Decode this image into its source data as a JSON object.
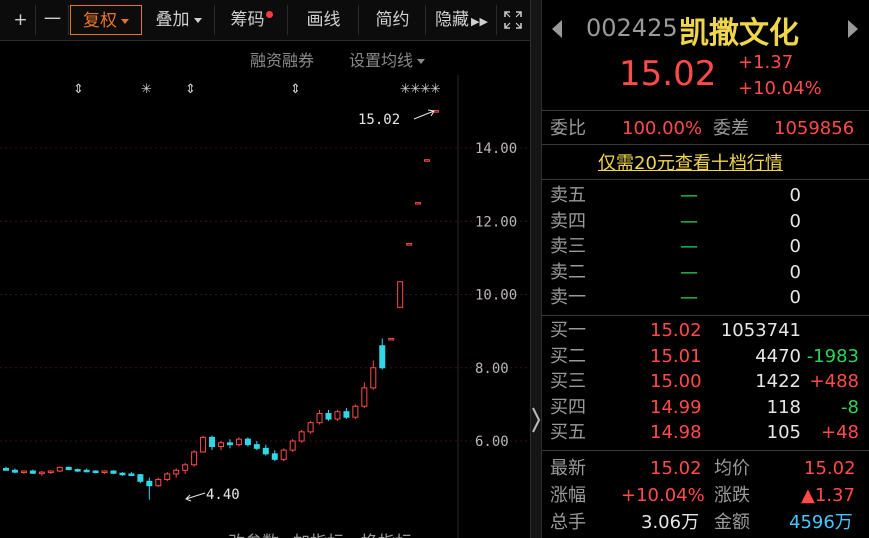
{
  "toolbar": {
    "plus": "+",
    "minus": "一",
    "fuquan": "复权",
    "diejia": "叠加",
    "chouma": "筹码",
    "huaxian": "画线",
    "jianyue": "简约",
    "yincang": "隐藏"
  },
  "chart_sub": {
    "rongzi": "融资融券",
    "junxian": "设置均线"
  },
  "chart_data": {
    "type": "candlestick",
    "yticks": [
      "14.00",
      "12.00",
      "10.00",
      "8.00",
      "6.00"
    ],
    "ylim": [
      4.0,
      15.6
    ],
    "annotation_high": "15.02",
    "annotation_low": "4.40",
    "candles": [
      [
        5.25,
        5.3,
        5.2,
        5.2
      ],
      [
        5.2,
        5.25,
        5.12,
        5.15
      ],
      [
        5.15,
        5.2,
        5.1,
        5.18
      ],
      [
        5.18,
        5.22,
        5.1,
        5.12
      ],
      [
        5.12,
        5.18,
        5.05,
        5.15
      ],
      [
        5.15,
        5.2,
        5.1,
        5.18
      ],
      [
        5.18,
        5.3,
        5.15,
        5.28
      ],
      [
        5.28,
        5.3,
        5.2,
        5.22
      ],
      [
        5.22,
        5.25,
        5.15,
        5.2
      ],
      [
        5.2,
        5.25,
        5.15,
        5.18
      ],
      [
        5.18,
        5.2,
        5.12,
        5.15
      ],
      [
        5.15,
        5.2,
        5.1,
        5.18
      ],
      [
        5.18,
        5.2,
        5.1,
        5.12
      ],
      [
        5.12,
        5.15,
        5.05,
        5.1
      ],
      [
        5.1,
        5.15,
        5.05,
        5.08
      ],
      [
        5.08,
        5.1,
        4.85,
        4.9
      ],
      [
        4.9,
        5.0,
        4.4,
        4.78
      ],
      [
        4.78,
        5.0,
        4.75,
        4.95
      ],
      [
        4.95,
        5.15,
        4.9,
        5.1
      ],
      [
        5.1,
        5.25,
        5.0,
        5.2
      ],
      [
        5.2,
        5.4,
        5.1,
        5.35
      ],
      [
        5.35,
        5.75,
        5.3,
        5.7
      ],
      [
        5.7,
        6.15,
        5.7,
        6.1
      ],
      [
        6.1,
        6.15,
        5.75,
        5.85
      ],
      [
        5.85,
        6.0,
        5.75,
        5.95
      ],
      [
        5.95,
        6.05,
        5.8,
        5.9
      ],
      [
        5.9,
        6.1,
        5.85,
        6.05
      ],
      [
        6.05,
        6.1,
        5.85,
        5.9
      ],
      [
        5.9,
        6.0,
        5.75,
        5.8
      ],
      [
        5.8,
        5.9,
        5.6,
        5.65
      ],
      [
        5.65,
        5.75,
        5.45,
        5.5
      ],
      [
        5.5,
        5.8,
        5.45,
        5.75
      ],
      [
        5.75,
        6.05,
        5.7,
        6.0
      ],
      [
        6.0,
        6.3,
        5.95,
        6.25
      ],
      [
        6.25,
        6.55,
        6.2,
        6.5
      ],
      [
        6.5,
        6.85,
        6.45,
        6.75
      ],
      [
        6.75,
        6.85,
        6.55,
        6.6
      ],
      [
        6.6,
        6.85,
        6.55,
        6.8
      ],
      [
        6.8,
        6.9,
        6.6,
        6.65
      ],
      [
        6.65,
        7.0,
        6.6,
        6.95
      ],
      [
        6.95,
        7.6,
        6.9,
        7.45
      ],
      [
        7.45,
        8.2,
        7.4,
        8.0
      ],
      [
        8.6,
        8.8,
        7.95,
        8.0
      ],
      [
        8.8,
        8.8,
        8.8,
        8.8
      ],
      [
        9.65,
        10.35,
        9.65,
        10.35
      ],
      [
        11.39,
        11.39,
        11.39,
        11.39
      ],
      [
        12.51,
        12.51,
        12.51,
        12.51
      ],
      [
        13.68,
        13.68,
        13.68,
        13.68
      ],
      [
        15.02,
        15.02,
        15.02,
        15.02
      ]
    ]
  },
  "stock": {
    "code": "002425",
    "name": "凯撒文化",
    "price": "15.02",
    "change": "+1.37",
    "change_pct": "+10.04%"
  },
  "weibi": {
    "label": "委比",
    "value": "100.00%",
    "label2": "委差",
    "value2": "1059856"
  },
  "promo": "仅需20元查看十档行情",
  "sell_orders": [
    {
      "label": "卖五",
      "price": "—",
      "vol": "0"
    },
    {
      "label": "卖四",
      "price": "—",
      "vol": "0"
    },
    {
      "label": "卖三",
      "price": "—",
      "vol": "0"
    },
    {
      "label": "卖二",
      "price": "—",
      "vol": "0"
    },
    {
      "label": "卖一",
      "price": "—",
      "vol": "0"
    }
  ],
  "buy_orders": [
    {
      "label": "买一",
      "price": "15.02",
      "vol": "1053741",
      "delta": ""
    },
    {
      "label": "买二",
      "price": "15.01",
      "vol": "4470",
      "delta": "-1983"
    },
    {
      "label": "买三",
      "price": "15.00",
      "vol": "1422",
      "delta": "+488"
    },
    {
      "label": "买四",
      "price": "14.99",
      "vol": "118",
      "delta": "-8"
    },
    {
      "label": "买五",
      "price": "14.98",
      "vol": "105",
      "delta": "+48"
    }
  ],
  "stats": {
    "latest_label": "最新",
    "latest": "15.02",
    "avg_label": "均价",
    "avg": "15.02",
    "pct_label": "涨幅",
    "pct": "+10.04%",
    "chg_label": "涨跌",
    "chg": "▲1.37",
    "hand_label": "总手",
    "hand": "3.06万",
    "amount_label": "金额",
    "amount": "4596万"
  },
  "bottom_tabs": [
    "改参数",
    "加指标",
    "换指标"
  ],
  "colors": {
    "up": "#ff4a4a",
    "down": "#2fd8e6",
    "accent": "#e8742a"
  }
}
